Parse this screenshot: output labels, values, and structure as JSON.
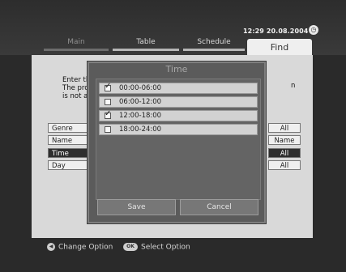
{
  "header": {
    "clock": "12:29 20.08.2004",
    "tabs": {
      "main": "Main",
      "table": "Table",
      "schedule": "Schedule",
      "find": "Find"
    }
  },
  "find": {
    "instruction_lines": [
      "Enter tl",
      "The pro",
      "is not a"
    ],
    "instruction_tail": "n",
    "options": [
      {
        "label": "Genre",
        "value": "All",
        "selected": false
      },
      {
        "label": "Name",
        "value": "Name",
        "selected": false
      },
      {
        "label": "Time",
        "value": "All",
        "selected": true
      },
      {
        "label": "Day",
        "value": "All",
        "selected": false
      }
    ]
  },
  "time_dialog": {
    "title": "Time",
    "slots": [
      {
        "label": "00:00-06:00",
        "checked": true
      },
      {
        "label": "06:00-12:00",
        "checked": false
      },
      {
        "label": "12:00-18:00",
        "checked": true
      },
      {
        "label": "18:00-24:00",
        "checked": false
      }
    ],
    "save_label": "Save",
    "cancel_label": "Cancel"
  },
  "footer": {
    "change_option": "Change Option",
    "select_option": "Select Option",
    "ok_key": "OK"
  }
}
